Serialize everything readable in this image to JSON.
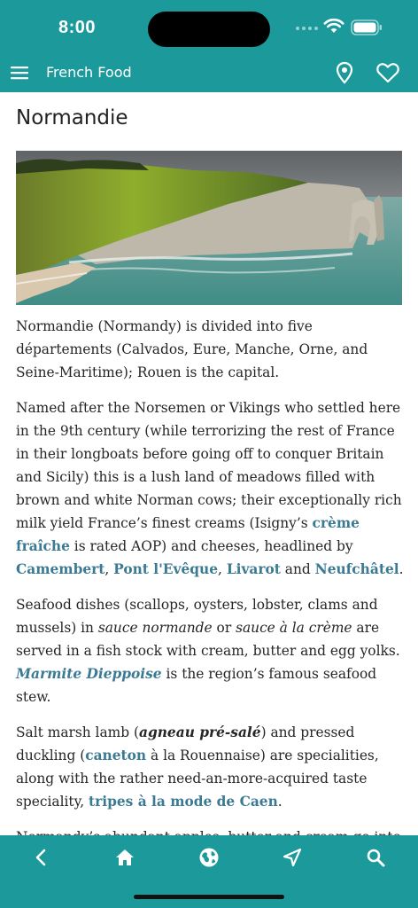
{
  "status": {
    "time": "8:00"
  },
  "header": {
    "title": "French Food"
  },
  "page": {
    "title": "Normandie"
  },
  "hero": {
    "alt": "Normandy coastline cliffs"
  },
  "article": {
    "p1": "Normandie (Normandy) is divided into five départements (Calvados, Eure, Manche, Orne, and Seine-Maritime); Rouen is the capital.",
    "p2": {
      "text1": "Named after the Norsemen or Vikings who settled here in the 9th century (while terrorizing the rest of France in their longboats before going off to conquer Britain and Sicily) this is a lush land of meadows filled with brown and white Norman cows; their exceptionally rich milk yield France’s finest creams (Isigny’s ",
      "link_creme": "crème fraîche",
      "text2": " is rated AOP) and cheeses, headlined by ",
      "link_camembert": "Camembert",
      "sep1": ", ",
      "link_pont": "Pont l'Evêque",
      "sep2": ", ",
      "link_livarot": "Livarot",
      "and": " and ",
      "link_neufchatel": "Neufchâtel",
      "end": "."
    },
    "p3": {
      "text1": "Seafood dishes (scallops, oysters, lobster, clams and mussels) in ",
      "em1": "sauce normande",
      "or": " or ",
      "em2": "sauce à la crème",
      "text2": " are served in a fish stock with cream, butter and egg yolks. ",
      "link_marmite": "Marmite Dieppoise",
      "text3": " is the region’s famous seafood stew."
    },
    "p4": {
      "text1": "Salt marsh lamb (",
      "bi": "agneau pré-salé",
      "text2": ") and pressed duckling (",
      "link_caneton": "caneton",
      "text3": " à la Rouennaise) are specialities, along with the rather need-an-more-acquired taste speciality, ",
      "link_tripes": "tripes à la mode de Caen",
      "end": "."
    },
    "p5": "Normandy’s abundant apples, butter and cream go into"
  },
  "toolbar": {
    "back": "chevron-left-icon",
    "home": "home-icon",
    "globe": "globe-icon",
    "navigate": "navigation-arrow-icon",
    "search": "search-icon"
  },
  "colors": {
    "accent": "#1c9a9b",
    "link": "#3b7a93",
    "text": "#262626"
  }
}
